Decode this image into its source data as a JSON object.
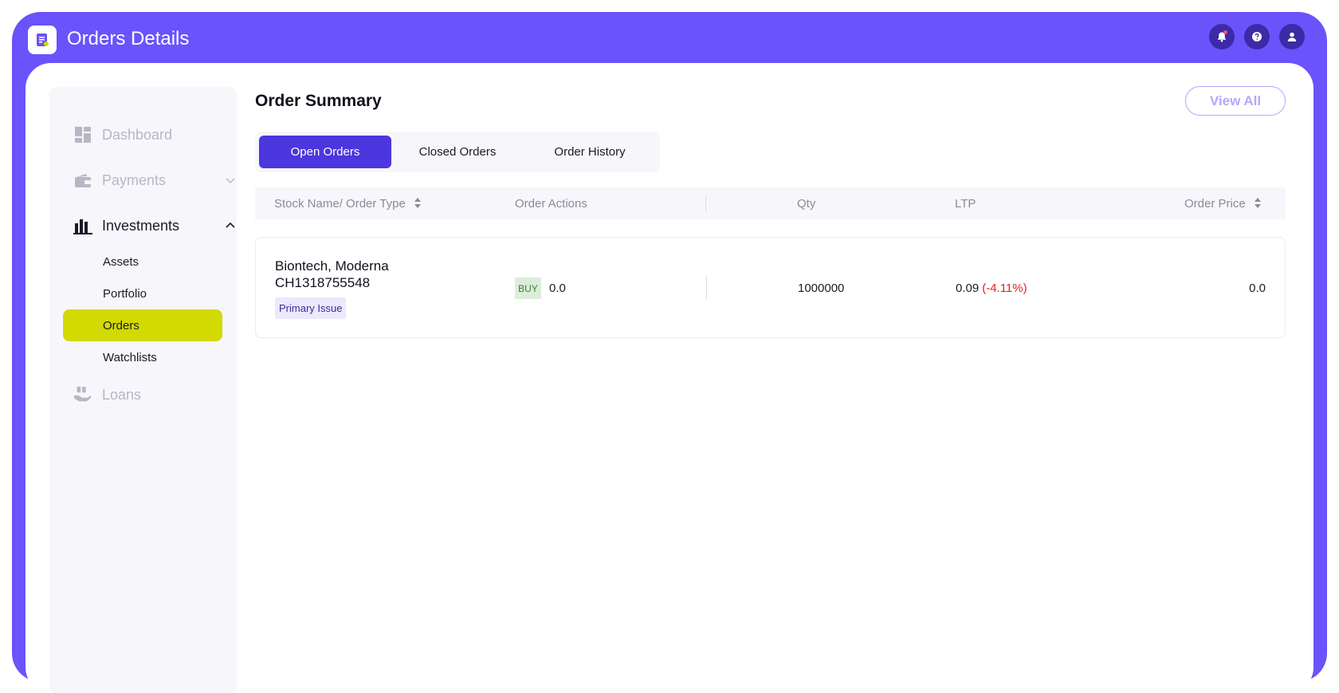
{
  "app": {
    "title": "Orders Details"
  },
  "sidebar": {
    "dashboard": "Dashboard",
    "payments": "Payments",
    "investments": "Investments",
    "sub_items": [
      "Assets",
      "Portfolio",
      "Orders",
      "Watchlists"
    ],
    "loans": "Loans"
  },
  "summary": {
    "title": "Order Summary",
    "view_all": "View All",
    "tabs": [
      "Open Orders",
      "Closed Orders",
      "Order History"
    ],
    "headers": [
      "Stock Name/ Order Type",
      "Order Actions",
      "Qty",
      "LTP",
      "Order Price"
    ]
  },
  "order": {
    "stock_line1": "Biontech, Moderna",
    "stock_line2": "CH1318755548",
    "type": "Primary Issue",
    "action": "BUY",
    "action_value": "0.0",
    "qty": "1000000",
    "ltp": "0.09",
    "ltp_change": "(-4.11%)",
    "order_price": "0.0"
  },
  "colors": {
    "brand": "#6a53fb",
    "active_tab": "#4c36de",
    "selected_nav": "#d3d902",
    "negative": "#e0221c"
  }
}
